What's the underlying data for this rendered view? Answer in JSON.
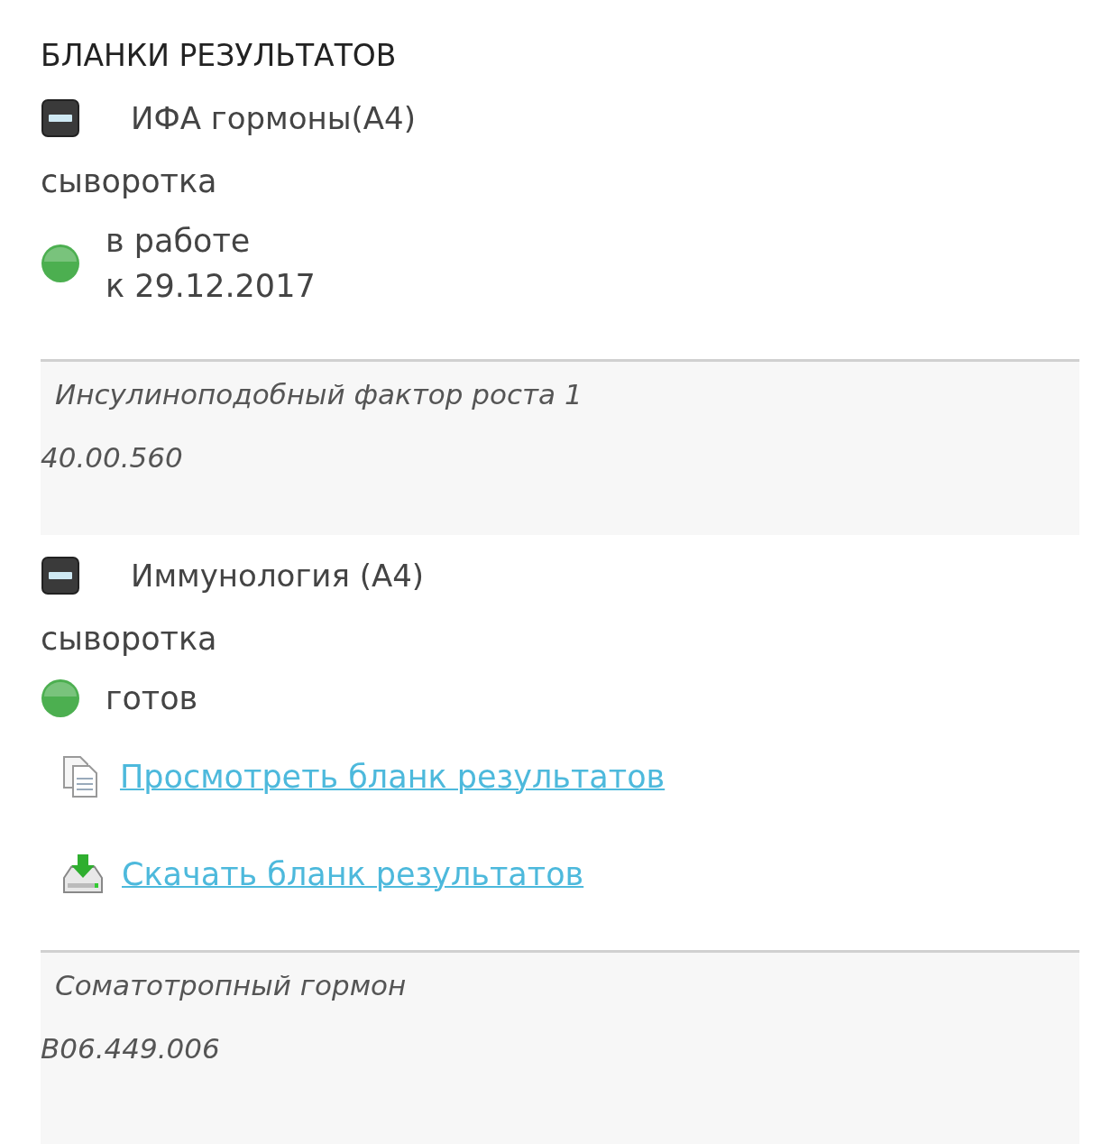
{
  "title": "БЛАНКИ РЕЗУЛЬТАТОВ",
  "groups": [
    {
      "name": "ИФА гормоны(A4)",
      "expanded": true,
      "sample": "сыворотка",
      "status": {
        "color": "#4caf50",
        "lines": [
          "в работе",
          "к 29.12.2017"
        ]
      },
      "test": {
        "name": "Инсулиноподобный фактор роста 1",
        "code": "40.00.560"
      }
    },
    {
      "name": "Иммунология (A4)",
      "expanded": true,
      "sample": "сыворотка",
      "status": {
        "color": "#4caf50",
        "lines": [
          "готов"
        ]
      },
      "links": [
        {
          "kind": "view",
          "label": "Просмотреть бланк результатов"
        },
        {
          "kind": "download",
          "label": "Скачать бланк результатов"
        }
      ],
      "test": {
        "name": "Соматотропный гормон",
        "code": "B06.449.006"
      }
    }
  ]
}
